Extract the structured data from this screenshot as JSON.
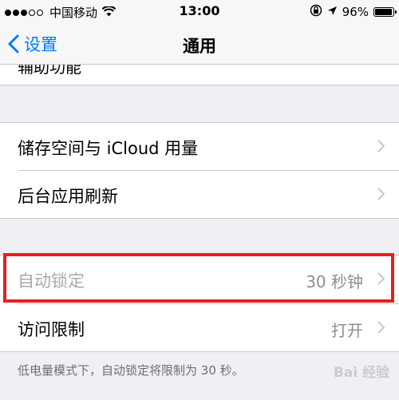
{
  "status_bar": {
    "carrier": "中国移动",
    "time": "13:00",
    "battery_percent": "96%",
    "battery_level": 0.96,
    "icons": [
      "signal-dots",
      "wifi-icon",
      "orientation-lock-icon",
      "location-arrow-icon",
      "battery-icon"
    ]
  },
  "nav": {
    "back_label": "设置",
    "title": "通用"
  },
  "clipped_row": {
    "label": "辅助功能"
  },
  "group1": [
    {
      "label": "储存空间与 iCloud 用量",
      "value": ""
    },
    {
      "label": "后台应用刷新",
      "value": ""
    }
  ],
  "group2": [
    {
      "label": "自动锁定",
      "value": "30 秒钟",
      "dimmed": true
    },
    {
      "label": "访问限制",
      "value": "打开"
    }
  ],
  "footer_note": "低电量模式下，自动锁定将限制为 30 秒。",
  "watermark": "Bai 经验",
  "colors": {
    "accent": "#007aff",
    "highlight": "#e52020",
    "background": "#efeff4"
  }
}
